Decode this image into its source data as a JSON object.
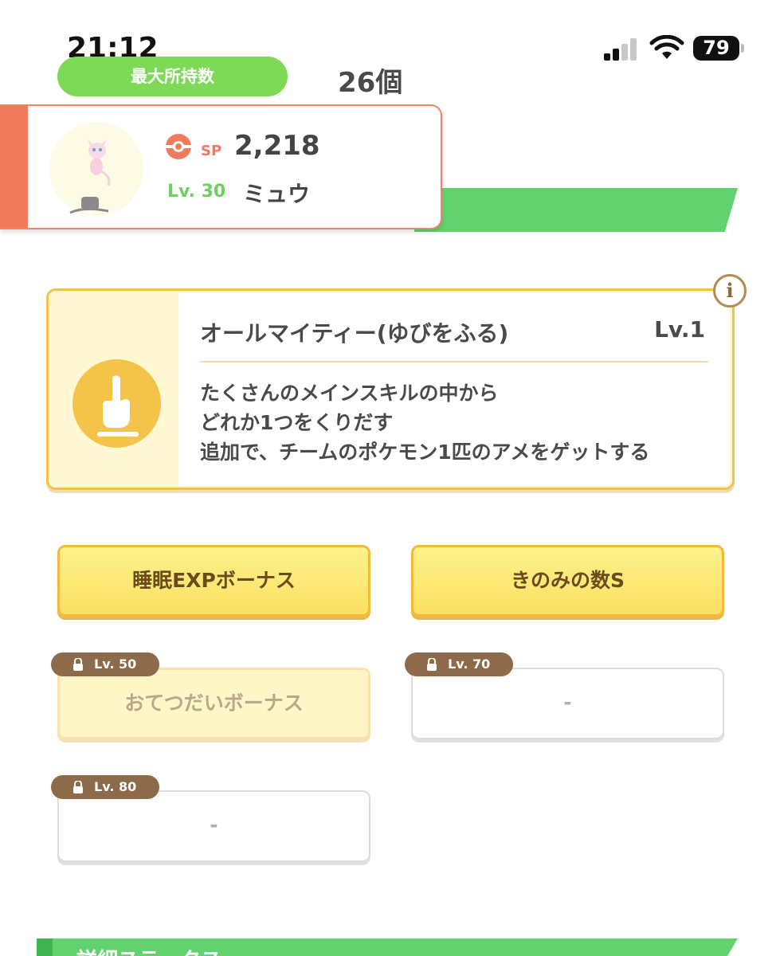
{
  "status_bar": {
    "time": "21:12",
    "battery": "79",
    "icons": [
      "signal-icon",
      "wifi-icon",
      "battery-icon"
    ]
  },
  "max_holding": {
    "label": "最大所持数",
    "value": "26個"
  },
  "pokemon": {
    "sp_label": "SP",
    "sp_value": "2,218",
    "level": "Lv. 30",
    "name": "ミュウ"
  },
  "main_skill": {
    "name": "オールマイティー(ゆびをふる)",
    "level": "Lv.1",
    "description": [
      "たくさんのメインスキルの中から",
      "どれか1つをくりだす",
      "追加で、チームのポケモン1匹のアメをゲットする"
    ],
    "info_label": "i"
  },
  "sub_skills": [
    {
      "label": "睡眠EXPボーナス",
      "state": "active"
    },
    {
      "label": "きのみの数S",
      "state": "active"
    },
    {
      "label": "おてつだいボーナス",
      "state": "locked",
      "unlock_level": "Lv. 50"
    },
    {
      "label": "-",
      "state": "locked",
      "unlock_level": "Lv. 70"
    },
    {
      "label": "-",
      "state": "locked",
      "unlock_level": "Lv. 80"
    }
  ],
  "section_title": "詳細ステータス",
  "colors": {
    "green": "#62d26f",
    "pill_green": "#7ed957",
    "salmon": "#ef7a5c",
    "skill_gold": "#f2c24a",
    "badge_brown": "#8c6a4a"
  }
}
